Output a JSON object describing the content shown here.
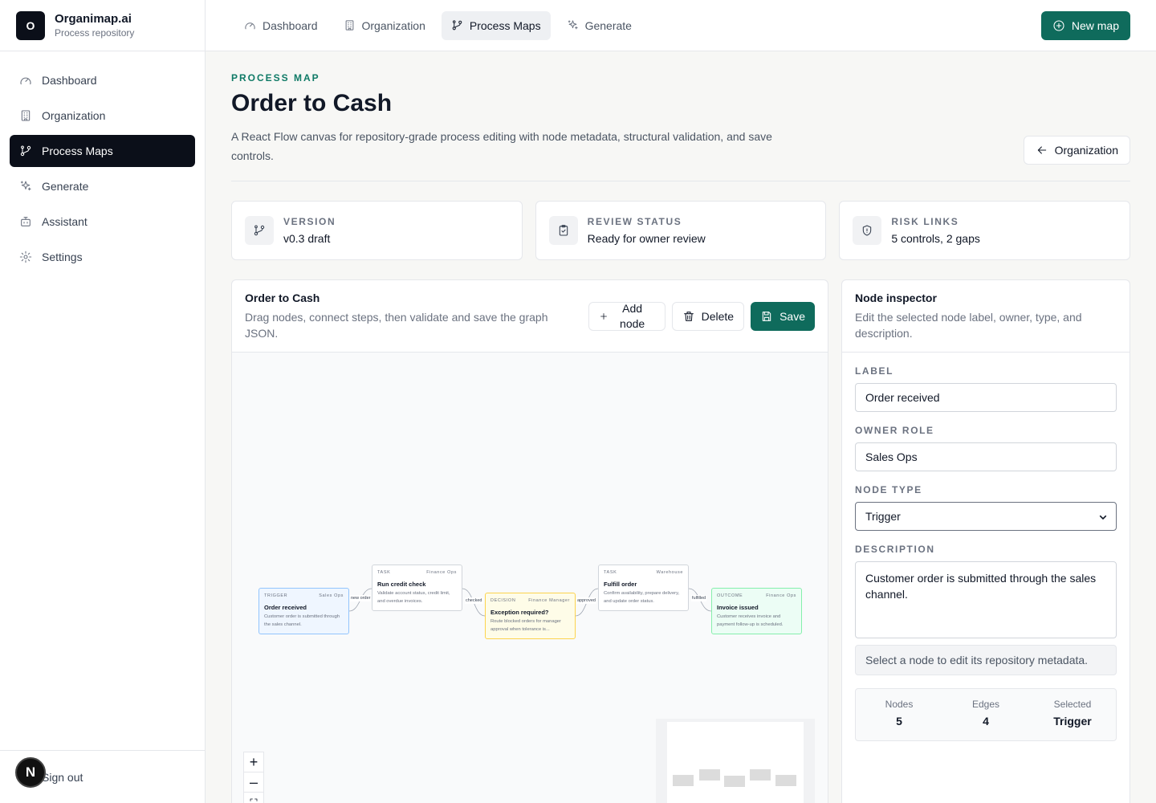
{
  "brand": {
    "initial": "O",
    "name": "Organimap.ai",
    "subtitle": "Process repository"
  },
  "sidebar": {
    "items": [
      {
        "label": "Dashboard",
        "icon": "gauge-icon"
      },
      {
        "label": "Organization",
        "icon": "building-icon"
      },
      {
        "label": "Process Maps",
        "icon": "git-branch-icon",
        "active": true
      },
      {
        "label": "Generate",
        "icon": "sparkles-icon"
      },
      {
        "label": "Assistant",
        "icon": "bot-icon"
      },
      {
        "label": "Settings",
        "icon": "gear-icon"
      }
    ],
    "sign_out": "Sign out",
    "avatar_initial": "N"
  },
  "topbar": {
    "tabs": [
      {
        "label": "Dashboard",
        "icon": "gauge-icon"
      },
      {
        "label": "Organization",
        "icon": "building-icon"
      },
      {
        "label": "Process Maps",
        "icon": "git-branch-icon",
        "active": true
      },
      {
        "label": "Generate",
        "icon": "sparkles-icon"
      }
    ],
    "new_map": "New map"
  },
  "header": {
    "eyebrow": "PROCESS MAP",
    "title": "Order to Cash",
    "description": "A React Flow canvas for repository-grade process editing with node metadata, structural validation, and save controls.",
    "back_button": "Organization"
  },
  "stats": [
    {
      "label": "VERSION",
      "value": "v0.3 draft",
      "icon": "git-branch-icon"
    },
    {
      "label": "REVIEW STATUS",
      "value": "Ready for owner review",
      "icon": "clipboard-check-icon"
    },
    {
      "label": "RISK LINKS",
      "value": "5 controls, 2 gaps",
      "icon": "shield-icon"
    }
  ],
  "canvas": {
    "title": "Order to Cash",
    "description": "Drag nodes, connect steps, then validate and save the graph JSON.",
    "add_node": "Add node",
    "delete": "Delete",
    "save": "Save",
    "nodes": [
      {
        "type": "TRIGGER",
        "owner": "Sales Ops",
        "title": "Order received",
        "desc": "Customer order is submitted through the sales channel."
      },
      {
        "type": "TASK",
        "owner": "Finance Ops",
        "title": "Run credit check",
        "desc": "Validate account status, credit limit, and overdue invoices."
      },
      {
        "type": "DECISION",
        "owner": "Finance Manager",
        "title": "Exception required?",
        "desc": "Route blocked orders for manager approval when tolerance is..."
      },
      {
        "type": "TASK",
        "owner": "Warehouse",
        "title": "Fulfill order",
        "desc": "Confirm availability, prepare delivery, and update order status."
      },
      {
        "type": "OUTCOME",
        "owner": "Finance Ops",
        "title": "Invoice issued",
        "desc": "Customer receives invoice and payment follow-up is scheduled."
      }
    ],
    "edges": [
      "new order",
      "checked",
      "approved",
      "fulfilled"
    ],
    "zoom_in": "+",
    "zoom_out": "–"
  },
  "inspector": {
    "title": "Node inspector",
    "description": "Edit the selected node label, owner, type, and description.",
    "label_label": "LABEL",
    "label_value": "Order received",
    "owner_label": "OWNER ROLE",
    "owner_value": "Sales Ops",
    "type_label": "NODE TYPE",
    "type_value": "Trigger",
    "description_label": "DESCRIPTION",
    "description_value": "Customer order is submitted through the sales channel.",
    "hint": "Select a node to edit its repository metadata.",
    "counts": [
      {
        "label": "Nodes",
        "value": "5"
      },
      {
        "label": "Edges",
        "value": "4"
      },
      {
        "label": "Selected",
        "value": "Trigger"
      }
    ]
  }
}
